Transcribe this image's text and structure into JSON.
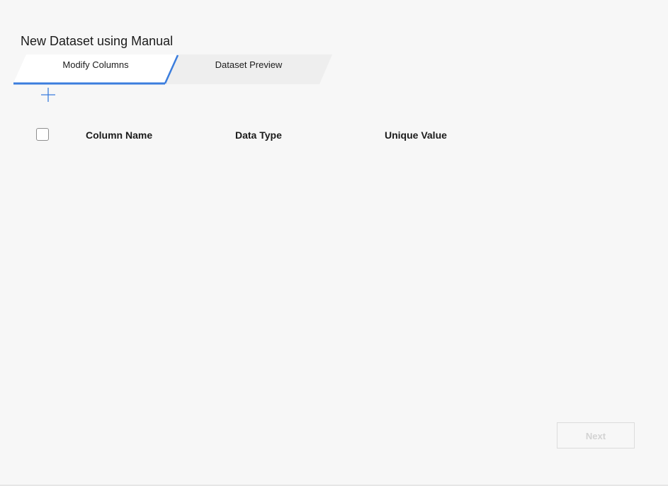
{
  "page": {
    "title": "New Dataset using Manual"
  },
  "tabs": [
    {
      "label": "Modify Columns",
      "active": true
    },
    {
      "label": "Dataset Preview",
      "active": false
    }
  ],
  "toolbar": {
    "add_icon": "plus-icon"
  },
  "table": {
    "columns": [
      "Column Name",
      "Data Type",
      "Unique Value"
    ],
    "rows": []
  },
  "footer": {
    "next_label": "Next",
    "next_enabled": false
  },
  "colors": {
    "accent": "#3b7ddd",
    "background": "#f7f7f7",
    "active_tab": "#ffffff",
    "inactive_tab": "#eeeeee"
  }
}
